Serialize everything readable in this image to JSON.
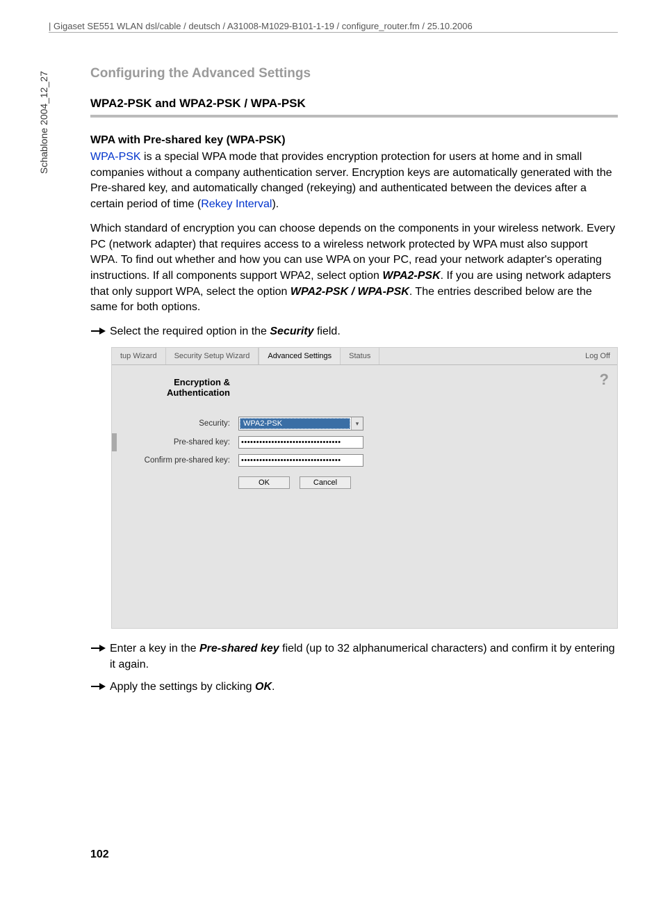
{
  "header": "| Gigaset SE551 WLAN dsl/cable / deutsch / A31008-M1029-B101-1-19 / configure_router.fm / 25.10.2006",
  "side_label": "Schablone 2004_12_27",
  "section_title": "Configuring the Advanced Settings",
  "sub_title": "WPA2-PSK and WPA2-PSK / WPA-PSK",
  "para_title": "WPA with Pre-shared key (WPA-PSK)",
  "p1": {
    "link1": "WPA-PSK",
    "t1": " is a special WPA mode that provides encryption protection for users at home and in small companies without a company authentication server. Encryption keys are automatically generated with the Pre-shared key, and automatically changed (rekeying) and authenticated between the devices after a certain period of time (",
    "link2": "Rekey Interval",
    "t2": ")."
  },
  "p2": {
    "t1": "Which standard of encryption you can choose depends on the components in your wireless network. Every PC (network adapter) that requires access to a wireless network protected by WPA must also support WPA. To find out whether and how you can use WPA on your PC, read your network adapter's operating instructions. If all components support WPA2, select option ",
    "b1": "WPA2-PSK",
    "t2": ". If you are using network adapters that only support WPA, select the option ",
    "b2": "WPA2-PSK / WPA-PSK",
    "t3": ". The entries described below are the same for both options."
  },
  "step1": {
    "t1": "Select the required option in the ",
    "b1": "Security",
    "t2": " field."
  },
  "shot": {
    "tabs": [
      "tup Wizard",
      "Security Setup Wizard",
      "Advanced Settings",
      "Status"
    ],
    "active_tab_index": 2,
    "logoff": "Log Off",
    "help": "?",
    "panel_title_l1": "Encryption &",
    "panel_title_l2": "Authentication",
    "rows": {
      "security": {
        "label": "Security:",
        "value": "WPA2-PSK"
      },
      "psk": {
        "label": "Pre-shared key:",
        "value": "•••••••••••••••••••••••••••••••••"
      },
      "confirm": {
        "label": "Confirm pre-shared key:",
        "value": "•••••••••••••••••••••••••••••••••"
      }
    },
    "buttons": {
      "ok": "OK",
      "cancel": "Cancel"
    }
  },
  "step2": {
    "t1": "Enter a key in the ",
    "b1": "Pre-shared key",
    "t2": " field (up to 32 alphanumerical characters) and confirm it by entering it again."
  },
  "step3": {
    "t1": "Apply the settings by clicking ",
    "b1": "OK",
    "t2": "."
  },
  "page_number": "102"
}
